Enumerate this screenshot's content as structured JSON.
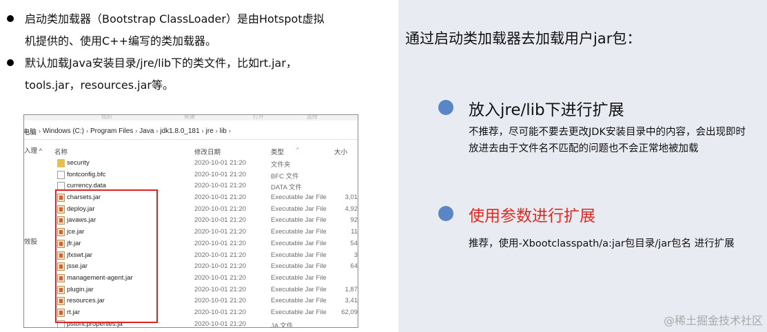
{
  "left": {
    "bullets": [
      {
        "lines": [
          "启动类加载器（Bootstrap ClassLoader）是由Hotspot虚拟",
          "机提供的、使用C++编写的类加载器。"
        ]
      },
      {
        "lines": [
          "默认加载Java安装目录/jre/lib下的类文件，比如rt.jar，",
          "tools.jar，resources.jar等。"
        ]
      }
    ],
    "explorer": {
      "ribbon_labels": [
        "组织",
        "新建",
        "打开",
        "选择"
      ],
      "nav_label_top": "入理 ^",
      "nav_label_mid": "效股",
      "address_prefix": "电脑",
      "breadcrumb": [
        "Windows (C:)",
        "Program Files",
        "Java",
        "jdk1.8.0_181",
        "jre",
        "lib"
      ],
      "columns": {
        "name": "名称",
        "date": "修改日期",
        "type": "类型",
        "size": "大小"
      },
      "files": [
        {
          "name": "security",
          "date": "2020-10-01 21:20",
          "type": "文件夹",
          "size": "",
          "icon": "folder-icon"
        },
        {
          "name": "fontconfig.bfc",
          "date": "2020-10-01 21:20",
          "type": "BFC 文件",
          "size": "",
          "icon": "file-icon"
        },
        {
          "name": "currency.data",
          "date": "2020-10-01 21:20",
          "type": "DATA 文件",
          "size": "",
          "icon": "file-icon"
        },
        {
          "name": "charsets.jar",
          "date": "2020-10-01 21:20",
          "type": "Executable Jar File",
          "size": "3,01",
          "icon": "jar-icon"
        },
        {
          "name": "deploy.jar",
          "date": "2020-10-01 21:20",
          "type": "Executable Jar File",
          "size": "4,92",
          "icon": "jar-icon"
        },
        {
          "name": "javaws.jar",
          "date": "2020-10-01 21:20",
          "type": "Executable Jar File",
          "size": "92",
          "icon": "jar-icon"
        },
        {
          "name": "jce.jar",
          "date": "2020-10-01 21:20",
          "type": "Executable Jar File",
          "size": "11",
          "icon": "jar-icon"
        },
        {
          "name": "jfr.jar",
          "date": "2020-10-01 21:20",
          "type": "Executable Jar File",
          "size": "54",
          "icon": "jar-icon"
        },
        {
          "name": "jfxswt.jar",
          "date": "2020-10-01 21:20",
          "type": "Executable Jar File",
          "size": "3",
          "icon": "jar-icon"
        },
        {
          "name": "jsse.jar",
          "date": "2020-10-01 21:20",
          "type": "Executable Jar File",
          "size": "64",
          "icon": "jar-icon"
        },
        {
          "name": "management-agent.jar",
          "date": "2020-10-01 21:20",
          "type": "Executable Jar File",
          "size": "",
          "icon": "jar-icon"
        },
        {
          "name": "plugin.jar",
          "date": "2020-10-01 21:20",
          "type": "Executable Jar File",
          "size": "1,87",
          "icon": "jar-icon"
        },
        {
          "name": "resources.jar",
          "date": "2020-10-01 21:20",
          "type": "Executable Jar File",
          "size": "3,41",
          "icon": "jar-icon"
        },
        {
          "name": "rt.jar",
          "date": "2020-10-01 21:20",
          "type": "Executable Jar File",
          "size": "62,09",
          "icon": "jar-icon"
        },
        {
          "name": "pstont.properties.ja",
          "date": "2020-10-01 21:20",
          "type": "JA 文件",
          "size": "",
          "icon": "file-icon"
        }
      ]
    }
  },
  "right": {
    "title": "通过启动类加载器去加载用户jar包：",
    "items": [
      {
        "heading": "放入jre/lib下进行扩展",
        "desc": "不推荐，尽可能不要去更改JDK安装目录中的内容，会出现即时放进去由于文件名不匹配的问题也不会正常地被加载"
      },
      {
        "heading": "使用参数进行扩展",
        "desc": "推荐，使用-Xbootclasspath/a:jar包目录/jar包名 进行扩展"
      }
    ],
    "watermark": "@稀土掘金技术社区"
  },
  "colors": {
    "panel_bg": "#e8ebf1",
    "bullet_blue": "#5a86c6",
    "accent_red": "#e0281e",
    "highlight_border": "#e02020"
  }
}
